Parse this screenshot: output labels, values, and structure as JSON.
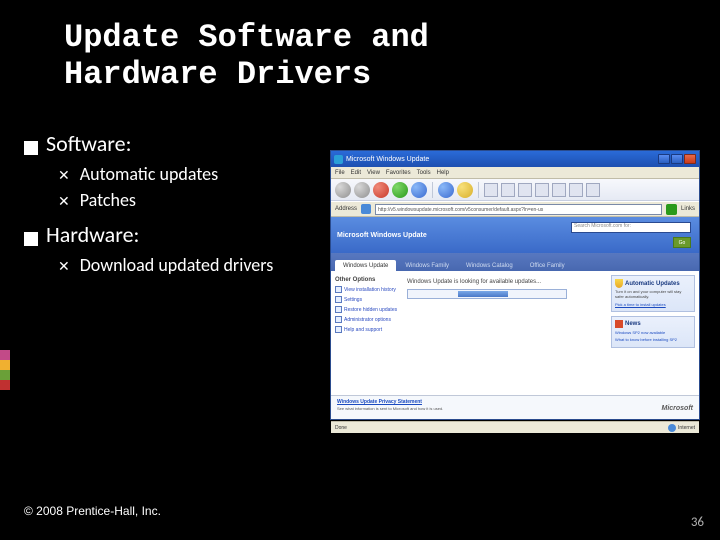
{
  "title_line1": "Update Software and",
  "title_line2": "Hardware Drivers",
  "bullets": {
    "software": "Software:",
    "software_sub": [
      "Automatic updates",
      "Patches"
    ],
    "hardware": "Hardware:",
    "hardware_sub": [
      "Download updated drivers"
    ]
  },
  "copyright": "© 2008 Prentice-Hall, Inc.",
  "slide_number": "36",
  "ie": {
    "title": "Microsoft Windows Update",
    "menu": [
      "File",
      "Edit",
      "View",
      "Favorites",
      "Tools",
      "Help"
    ],
    "addr_label": "Address",
    "url": "http://v5.windowsupdate.microsoft.com/v5consumer/default.aspx?ln=en-us",
    "links_label": "Links"
  },
  "wu": {
    "logo": "Microsoft Windows Update",
    "search_placeholder": "Search Microsoft.com for:",
    "go": "Go",
    "tabs": [
      "Windows Update",
      "Windows Family",
      "Windows Catalog",
      "Office Family"
    ],
    "sidebar_header": "Other Options",
    "sidebar_links": [
      "View installation history",
      "Settings",
      "Restore hidden updates",
      "Administrator options",
      "Help and support"
    ],
    "progress_text": "Windows Update is looking for available updates...",
    "auto_title": "Automatic Updates",
    "auto_body": "Turn it on and your computer will stay safer automatically.",
    "auto_link": "Pick a time to install updates",
    "news_title": "News",
    "news_items": [
      "Windows SP2 now available",
      "What to know before installing SP2"
    ],
    "bottom_title": "Windows Update Privacy Statement",
    "bottom_body": "See what information is sent to Microsoft and how it is used.",
    "ms_brand": "Microsoft",
    "status_done": "Done",
    "status_zone": "Internet"
  }
}
